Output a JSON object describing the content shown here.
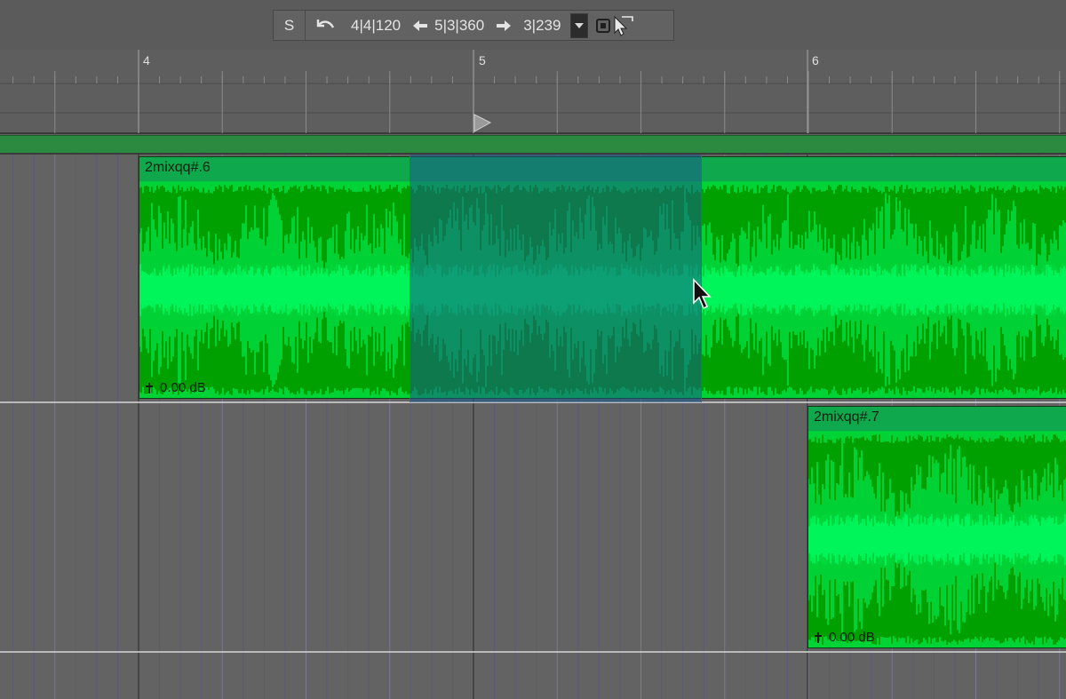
{
  "toolbar": {
    "snap_label": "S",
    "start_position": "4|4|120",
    "end_position": "5|3|360",
    "length": "3|239",
    "icons": {
      "undo": "undo-icon",
      "left_arrow": "arrow-left-icon",
      "right_arrow": "arrow-right-icon",
      "dropdown": "chevron-down-icon",
      "snap_tool": "pointer-tool-icon"
    }
  },
  "ruler": {
    "bars": [
      "4",
      "5",
      "6"
    ]
  },
  "regions": [
    {
      "name": "2mixqq#.6",
      "gain": "0.00 dB"
    },
    {
      "name": "2mixqq#.7",
      "gain": "0.00 dB"
    }
  ],
  "colors": {
    "region_fill": "#00a000",
    "region_header": "#10a84c",
    "waveform": "#00f55a",
    "selection": "#195a8c",
    "marker_lane": "#2c8a40",
    "background": "#5f5f5f"
  }
}
